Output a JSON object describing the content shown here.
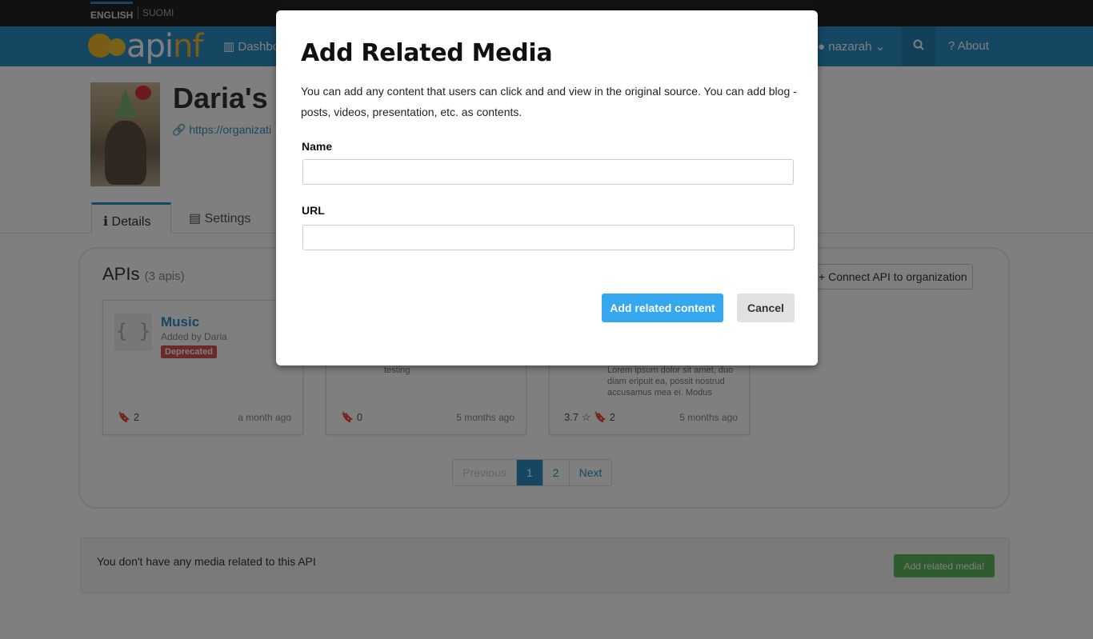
{
  "languages": {
    "english": "ENGLISH",
    "finnish": "SUOMI"
  },
  "nav": {
    "logo_text_a": "api",
    "logo_text_b": "nf",
    "dashboard": "Dashbo",
    "user": "nazarah",
    "about": "About"
  },
  "org": {
    "title": "Daria's c",
    "url": "https://organizati"
  },
  "tabs": {
    "details": "Details",
    "settings": "Settings"
  },
  "apis": {
    "title": "APIs",
    "count": "(3 apis)",
    "connect_button": "Connect API to organization",
    "cards": [
      {
        "name": "Music",
        "added_by": "Added by Daria",
        "badge": "Deprecated",
        "description": "",
        "rating": "",
        "bookmarks": "2",
        "time": "a month ago"
      },
      {
        "name": "",
        "added_by": "",
        "badge": "",
        "description": "testing",
        "rating": "",
        "bookmarks": "0",
        "time": "5 months ago"
      },
      {
        "name": "",
        "added_by": "",
        "badge": "",
        "description": "Lorem ipsum dolor sit amet, duo diam eripuit ea, possit nostrud accusamus mea ei. Modus",
        "rating": "3.7",
        "bookmarks": "2",
        "time": "5 months ago"
      }
    ]
  },
  "pagination": {
    "previous": "Previous",
    "page1": "1",
    "page2": "2",
    "next": "Next",
    "current_page": 1
  },
  "media": {
    "message": "You don't have any media related to this API",
    "add_button": "Add related media!"
  },
  "modal": {
    "title": "Add Related Media",
    "intro": "You can add any content that users can click and  and view in the original source. You can add blog -posts, videos, presentation, etc. as contents.",
    "name_label": "Name",
    "name_value": "",
    "url_label": "URL",
    "url_value": "",
    "add_button": "Add related content",
    "cancel_button": "Cancel"
  },
  "colors": {
    "primary": "#2a8fc7",
    "modal_button": "#35a7ee",
    "success": "#5cb85c",
    "danger": "#d9534f"
  }
}
